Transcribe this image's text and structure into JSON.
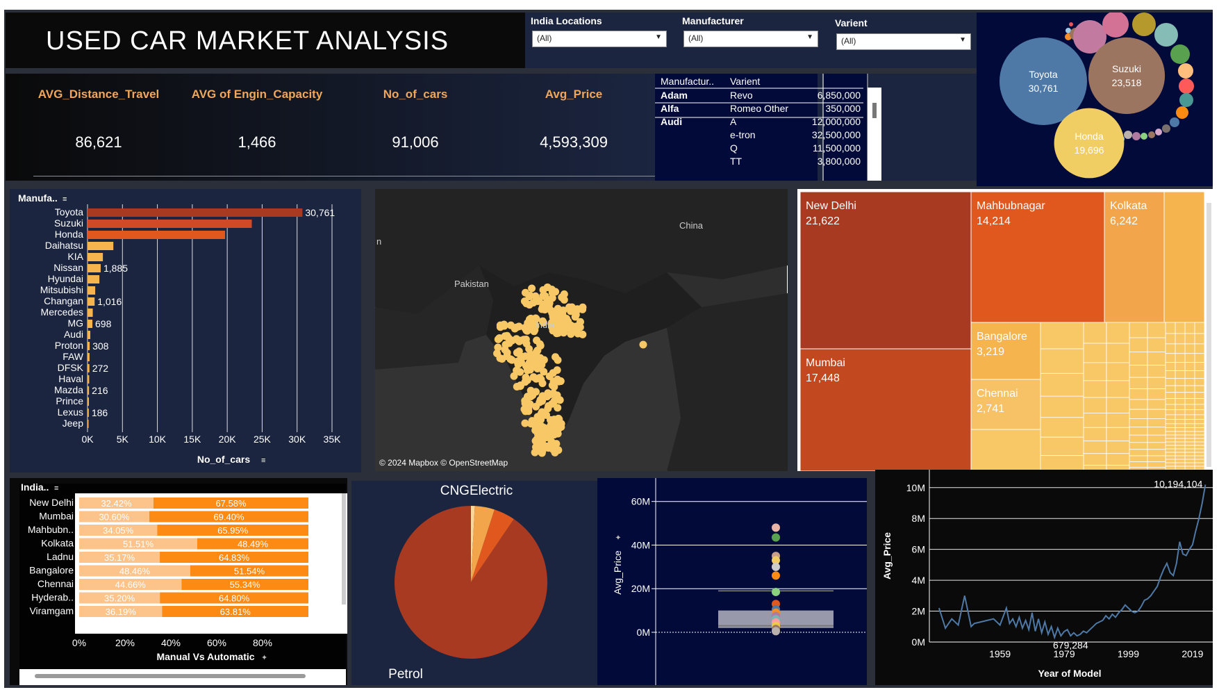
{
  "title": "USED CAR MARKET ANALYSIS",
  "filters": [
    {
      "label": "India Locations",
      "value": "(All)"
    },
    {
      "label": "Manufacturer",
      "value": "(All)"
    },
    {
      "label": "Varient",
      "value": "(All)"
    }
  ],
  "kpis": [
    {
      "label": "AVG_Distance_Travel",
      "value": "86,621"
    },
    {
      "label": "AVG of Engin_Capacity",
      "value": "1,466"
    },
    {
      "label": "No_of_cars",
      "value": "91,006"
    },
    {
      "label": "Avg_Price",
      "value": "4,593,309"
    }
  ],
  "price_table": {
    "headers": [
      "Manufactur..",
      "Varient",
      ""
    ],
    "rows": [
      {
        "manufacturer": "Adam",
        "variant": "Revo",
        "price": "6,850,000"
      },
      {
        "manufacturer": "Alfa",
        "variant": "Romeo Other",
        "price": "350,000"
      },
      {
        "manufacturer": "Audi",
        "variant": "A",
        "price": "12,000,000"
      },
      {
        "manufacturer": "",
        "variant": "e-tron",
        "price": "32,500,000"
      },
      {
        "manufacturer": "",
        "variant": "Q",
        "price": "11,500,000"
      },
      {
        "manufacturer": "",
        "variant": "TT",
        "price": "3,800,000"
      }
    ]
  },
  "map": {
    "labels": [
      "China",
      "Pakistan",
      "India",
      "n"
    ],
    "attribution": "© 2024 Mapbox © OpenStreetMap"
  },
  "colors": {
    "dark_orange": "#a93a22",
    "orange": "#e0581e",
    "light_orange": "#f5b44e",
    "yellow": "#f7c865",
    "bright_orange": "#fd8a12",
    "pale_orange": "#fcc48a",
    "blue_line": "#4e79a7"
  },
  "chart_data": [
    {
      "type": "bubble",
      "name": "manufacturer-bubbles",
      "bubbles": [
        {
          "label": "Toyota",
          "value": 30761,
          "value_label": "30,761",
          "color": "#4e79a7"
        },
        {
          "label": "Suzuki",
          "value": 23518,
          "value_label": "23,518",
          "color": "#9c7560"
        },
        {
          "label": "Honda",
          "value": 19696,
          "value_label": "19,696",
          "color": "#f1ce63"
        }
      ]
    },
    {
      "type": "bar",
      "orientation": "horizontal",
      "header": "Manufa..",
      "xlabel": "No_of_cars",
      "xlim": [
        0,
        35000
      ],
      "xticks": [
        "0K",
        "5K",
        "10K",
        "15K",
        "20K",
        "25K",
        "30K",
        "35K"
      ],
      "categories": [
        "Toyota",
        "Suzuki",
        "Honda",
        "Daihatsu",
        "KIA",
        "Nissan",
        "Hyundai",
        "Mitsubishi",
        "Changan",
        "Mercedes",
        "MG",
        "Audi",
        "Proton",
        "FAW",
        "DFSK",
        "Haval",
        "Mazda",
        "Prince",
        "Lexus",
        "Jeep"
      ],
      "values": [
        30761,
        23518,
        19696,
        3700,
        2200,
        1885,
        1700,
        1100,
        1016,
        750,
        698,
        400,
        308,
        290,
        272,
        240,
        216,
        200,
        186,
        150
      ],
      "data_labels": [
        "30,761",
        "",
        "",
        "",
        "",
        "1,885",
        "",
        "",
        "1,016",
        "",
        "698",
        "",
        "308",
        "",
        "272",
        "",
        "216",
        "",
        "186",
        ""
      ]
    },
    {
      "type": "treemap",
      "items": [
        {
          "label": "New Delhi",
          "value": 21622,
          "value_label": "21,622"
        },
        {
          "label": "Mumbai",
          "value": 17448,
          "value_label": "17,448"
        },
        {
          "label": "Mahbubnagar",
          "value": 14214,
          "value_label": "14,214"
        },
        {
          "label": "Kolkata",
          "value": 6242,
          "value_label": "6,242"
        },
        {
          "label": "Bangalore",
          "value": 3219,
          "value_label": "3,219"
        },
        {
          "label": "Chennai",
          "value": 2741,
          "value_label": "2,741"
        }
      ]
    },
    {
      "type": "bar",
      "orientation": "horizontal",
      "stacked": "100%",
      "header": "India..",
      "xlabel": "Manual Vs Automatic",
      "xticks": [
        "0%",
        "20%",
        "40%",
        "60%",
        "80%"
      ],
      "categories": [
        "New Delhi",
        "Mumbai",
        "Mahbubn..",
        "Kolkata",
        "Ladnu",
        "Bangalore",
        "Chennai",
        "Hyderab..",
        "Viramgam"
      ],
      "series": [
        {
          "values": [
            32.42,
            30.6,
            34.05,
            51.51,
            35.17,
            48.46,
            44.66,
            35.2,
            36.19
          ],
          "labels": [
            "32.42%",
            "30.60%",
            "34.05%",
            "51.51%",
            "35.17%",
            "48.46%",
            "44.66%",
            "35.20%",
            "36.19%"
          ]
        },
        {
          "values": [
            67.58,
            69.4,
            65.95,
            48.49,
            64.83,
            51.54,
            55.34,
            64.8,
            63.81
          ],
          "labels": [
            "67.58%",
            "69.40%",
            "65.95%",
            "48.49%",
            "64.83%",
            "51.54%",
            "55.34%",
            "64.80%",
            "63.81%"
          ]
        }
      ]
    },
    {
      "type": "pie",
      "slices": [
        {
          "label": "Petrol",
          "value": 90.5,
          "color": "#a93a22"
        },
        {
          "label": "",
          "value": 4.5,
          "color": "#e0581e"
        },
        {
          "label": "",
          "value": 4.2,
          "color": "#f2a54a"
        },
        {
          "label": "",
          "value": 0.8,
          "color": "#fcd59a"
        }
      ],
      "top_label": "CNGElectric"
    },
    {
      "type": "scatter",
      "subtype": "box-plot",
      "ylabel": "Avg_Price",
      "ylim": [
        0,
        65000000
      ],
      "yticks": [
        "0M",
        "20M",
        "40M",
        "60M"
      ],
      "box": {
        "q1": 2000000,
        "median": 3000000,
        "q3": 10000000,
        "whisker_low": 0,
        "whisker_high": 19000000
      },
      "points": [
        {
          "y": 48000000,
          "color": "#e8b4a8"
        },
        {
          "y": 43500000,
          "color": "#59a14f"
        },
        {
          "y": 35000000,
          "color": "#c9a08a"
        },
        {
          "y": 33000000,
          "color": "#f1ce63"
        },
        {
          "y": 30000000,
          "color": "#cccccc"
        },
        {
          "y": 26000000,
          "color": "#fd8a12"
        },
        {
          "y": 18500000,
          "color": "#8cd17d"
        },
        {
          "y": 13000000,
          "color": "#e0581e"
        },
        {
          "y": 10500000,
          "color": "#4e79a7"
        },
        {
          "y": 9000000,
          "color": "#f28e2b"
        },
        {
          "y": 7500000,
          "color": "#b07aa1"
        },
        {
          "y": 6000000,
          "color": "#76b7b2"
        },
        {
          "y": 4500000,
          "color": "#ff9da7"
        },
        {
          "y": 3000000,
          "color": "#edc948"
        },
        {
          "y": 1500000,
          "color": "#9c755f"
        },
        {
          "y": 500000,
          "color": "#bab0ac"
        }
      ]
    },
    {
      "type": "line",
      "xlabel": "Year of Model",
      "ylabel": "Avg_Price",
      "xticks": [
        1959,
        1979,
        1999,
        2019
      ],
      "yticks": [
        "0M",
        "2M",
        "4M",
        "6M",
        "8M",
        "10M"
      ],
      "xlim": [
        1937,
        2024
      ],
      "ylim": [
        0,
        10800000
      ],
      "annotations": [
        {
          "x": 2023,
          "y": 10194104,
          "text": "10,194,104"
        },
        {
          "x": 1981,
          "y": 200000,
          "text": "679,284"
        }
      ],
      "x": [
        1940,
        1942,
        1944,
        1946,
        1948,
        1950,
        1951,
        1953,
        1955,
        1957,
        1959,
        1961,
        1962,
        1963,
        1964,
        1965,
        1966,
        1967,
        1968,
        1969,
        1970,
        1971,
        1972,
        1973,
        1974,
        1975,
        1976,
        1977,
        1978,
        1979,
        1980,
        1981,
        1982,
        1983,
        1984,
        1985,
        1986,
        1987,
        1988,
        1989,
        1990,
        1991,
        1992,
        1993,
        1994,
        1995,
        1996,
        1997,
        1998,
        1999,
        2000,
        2001,
        2002,
        2003,
        2004,
        2005,
        2006,
        2007,
        2008,
        2009,
        2010,
        2011,
        2012,
        2013,
        2014,
        2015,
        2016,
        2017,
        2018,
        2019,
        2020,
        2021,
        2022,
        2023
      ],
      "y": [
        2200000,
        900000,
        1500000,
        1100000,
        3000000,
        1000000,
        1200000,
        1300000,
        1400000,
        1500000,
        1100000,
        2200000,
        1200000,
        1500000,
        1000000,
        1600000,
        900000,
        1400000,
        800000,
        1900000,
        700000,
        1500000,
        600000,
        1300000,
        500000,
        1000000,
        300000,
        900000,
        400000,
        679284,
        800000,
        400000,
        600000,
        400000,
        500000,
        700000,
        600000,
        800000,
        1000000,
        1200000,
        1300000,
        1400000,
        1700000,
        1500000,
        1800000,
        1600000,
        1900000,
        2100000,
        2400000,
        2200000,
        2000000,
        1900000,
        2000000,
        2300000,
        2700000,
        2800000,
        3000000,
        3300000,
        3600000,
        4200000,
        4700000,
        5100000,
        4500000,
        4300000,
        5100000,
        6500000,
        5700000,
        5600000,
        6000000,
        6300000,
        7200000,
        8000000,
        9000000,
        10194104
      ]
    }
  ]
}
